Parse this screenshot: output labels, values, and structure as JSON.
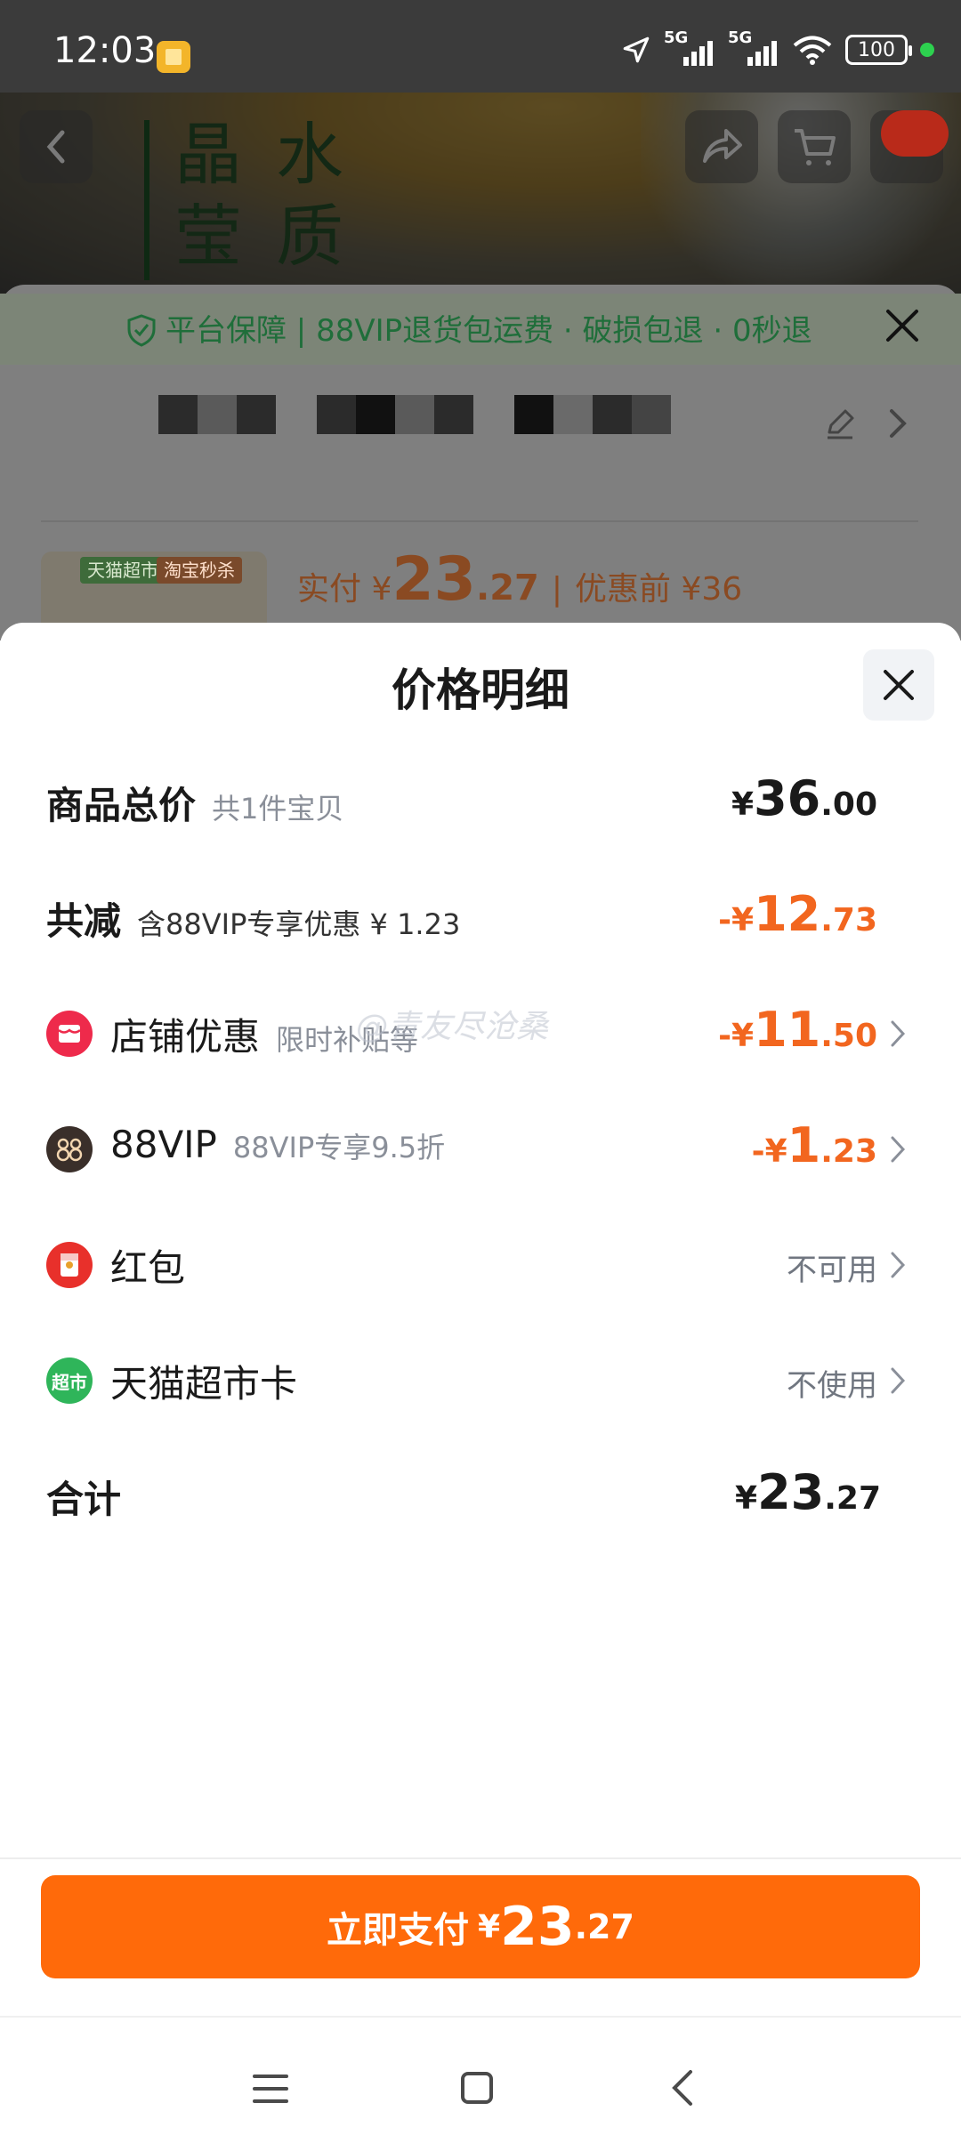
{
  "status_bar": {
    "time": "12:03",
    "net1": "5G",
    "net2": "5G",
    "battery": "100"
  },
  "background": {
    "product_text_col1": "晶莹",
    "product_text_col2": "水质",
    "guarantee": "平台保障 | 88VIP退货包运费 · 破损包退 · 0秒退",
    "thumb_tag_1": "天猫超市",
    "thumb_tag_2": "淘宝秒杀",
    "paid_label": "实付 ¥",
    "paid_int": "23",
    "paid_dec": ".27",
    "separator": "|",
    "before_discount": "优惠前 ¥36"
  },
  "sheet": {
    "title": "价格明细",
    "rows": [
      {
        "label": "商品总价",
        "sub": "共1件宝贝",
        "currency": "¥",
        "int": "36",
        "dec": ".00"
      },
      {
        "label": "共减",
        "sub": "含88VIP专享优惠 ¥ 1.23",
        "currency": "-¥",
        "int": "12",
        "dec": ".73"
      },
      {
        "label": "店铺优惠",
        "sub": "限时补贴等",
        "currency": "-¥",
        "int": "11",
        "dec": ".50",
        "icon": "store-coupon-icon"
      },
      {
        "label": "88VIP",
        "sub": "88VIP专享9.5折",
        "currency": "-¥",
        "int": "1",
        "dec": ".23",
        "icon": "vip-88-icon"
      },
      {
        "label": "红包",
        "status": "不可用",
        "icon": "red-packet-icon"
      },
      {
        "label": "天猫超市卡",
        "status": "不使用",
        "icon": "supermarket-card-icon",
        "icon_text": "超市"
      },
      {
        "label": "合计",
        "currency": "¥",
        "int": "23",
        "dec": ".27"
      }
    ],
    "watermark": "@青友尽沧桑",
    "pay_button": {
      "label": "立即支付",
      "currency": "¥",
      "int": "23",
      "dec": ".27"
    }
  },
  "colors": {
    "accent_orange": "#ff6a0a",
    "discount_orange": "#f2661f",
    "vip_badge": "#3a2f2a",
    "store_icon": "#ee2a4b",
    "red_packet_icon": "#e8302b",
    "card_icon": "#2fb55a"
  },
  "icons": {
    "statusbar": [
      "notification-icon",
      "location-icon",
      "signal-icon",
      "wifi-icon",
      "battery-icon"
    ],
    "nav": [
      "menu-icon",
      "home-icon",
      "back-icon"
    ]
  }
}
